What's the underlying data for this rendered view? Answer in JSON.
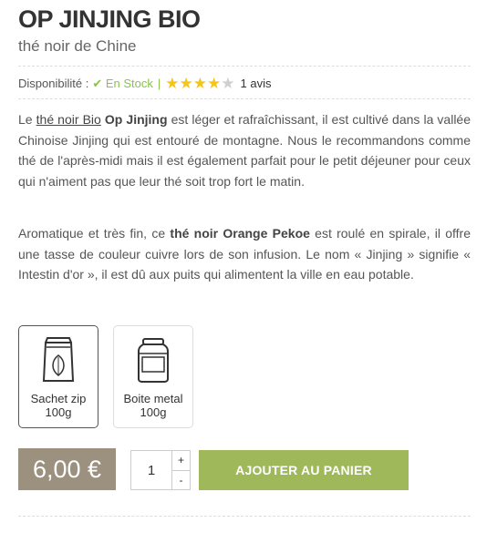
{
  "product": {
    "title": "OP JINJING BIO",
    "subtitle": "thé noir de Chine"
  },
  "availability": {
    "label": "Disponibilité :",
    "check_icon": "check-icon",
    "status": "En Stock",
    "separator": "|",
    "rating": 4,
    "rating_max": 5,
    "reviews": "1 avis"
  },
  "description": {
    "p1": {
      "t1": "Le ",
      "link1": "thé noir Bio",
      "t2": " ",
      "b1": "Op Jinjing",
      "t3": " est léger et rafraîchissant, il est cultivé dans la vallée Chinoise Jinjing qui est entouré de montagne. Nous le recommandons comme thé de l'après-midi mais il est également parfait pour le petit déjeuner pour ceux qui n'aiment pas que leur thé soit trop fort le matin."
    },
    "p2": {
      "t1": "Aromatique et très fin, ce ",
      "b1": "thé noir Orange Pekoe",
      "t2": " est roulé en spirale, il offre une tasse de couleur cuivre lors de son infusion. Le nom « Jinjing » signifie « Intestin d'or », il est dû aux puits qui alimentent la ville en eau potable."
    }
  },
  "options": [
    {
      "line1": "Sachet zip",
      "line2": "100g",
      "icon": "zip-bag-icon",
      "selected": true
    },
    {
      "line1": "Boite metal",
      "line2": "100g",
      "icon": "metal-tin-icon",
      "selected": false
    }
  ],
  "purchase": {
    "price": "6,00 €",
    "quantity": "1",
    "plus": "+",
    "minus": "-",
    "add_to_cart": "AJOUTER AU PANIER"
  },
  "colors": {
    "price_bg": "#9c917f",
    "button_bg": "#9fb85a",
    "stock_green": "#8bc34a",
    "star_on": "#f5c518",
    "star_off": "#cfcfcf"
  }
}
